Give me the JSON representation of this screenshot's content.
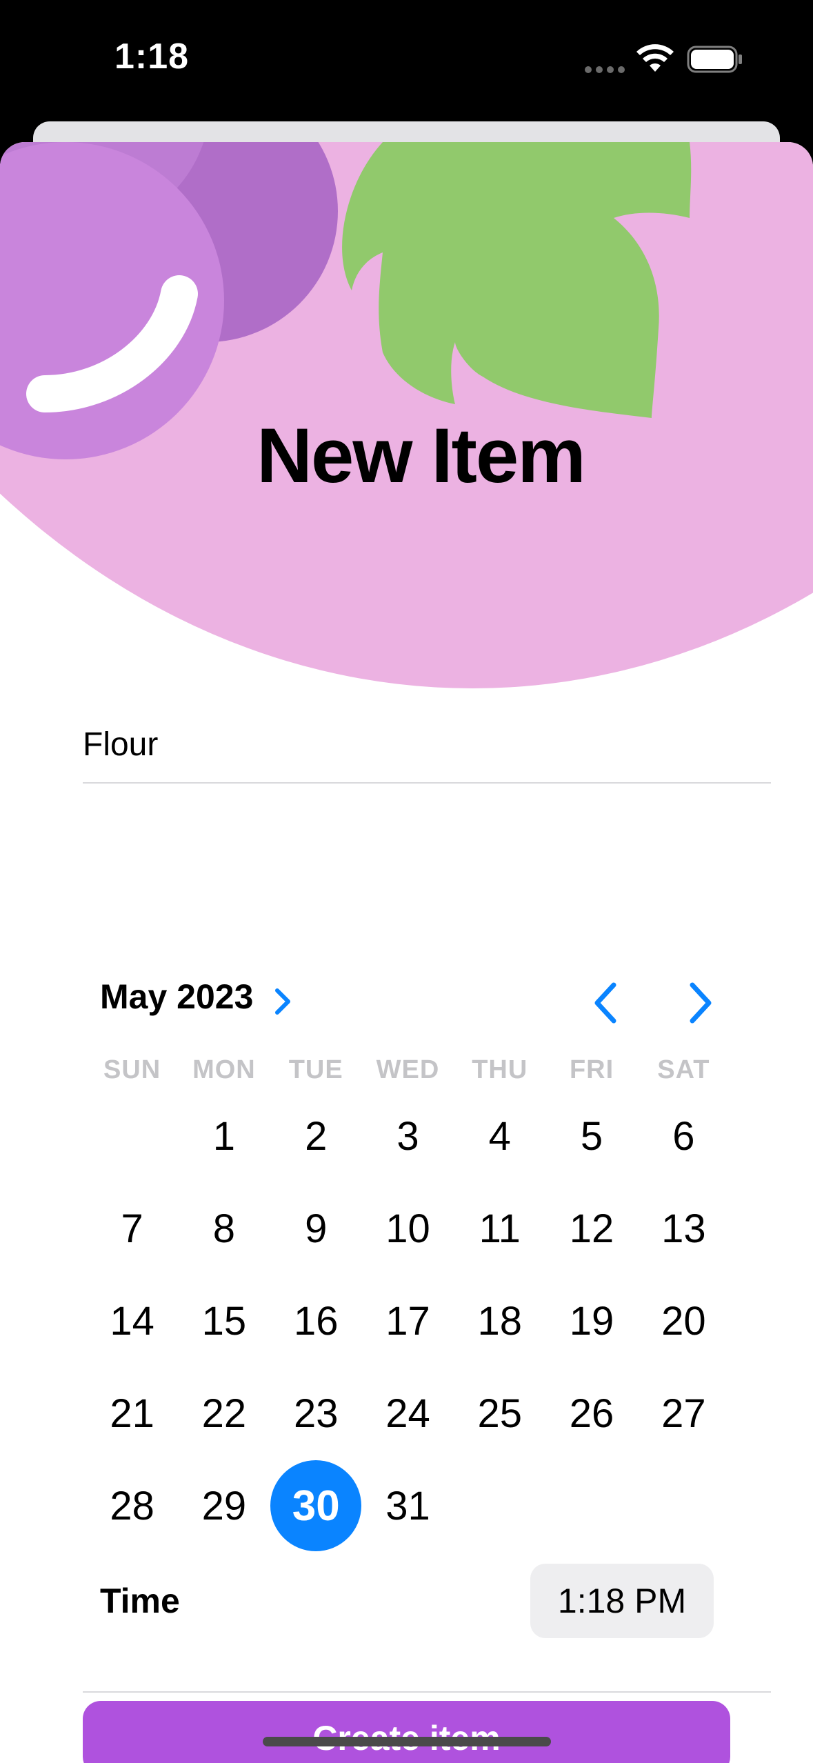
{
  "status_bar": {
    "time": "1:18",
    "icons": [
      "signal-dots-icon",
      "wifi-icon",
      "battery-icon"
    ]
  },
  "header": {
    "title": "New Item",
    "art": "grapes-illustration",
    "background_color": "#ecb2e2"
  },
  "form": {
    "name_value": "Flour",
    "calendar": {
      "month_label": "May 2023",
      "weekdays": [
        "SUN",
        "MON",
        "TUE",
        "WED",
        "THU",
        "FRI",
        "SAT"
      ],
      "leading_blanks": 1,
      "days": [
        "1",
        "2",
        "3",
        "4",
        "5",
        "6",
        "7",
        "8",
        "9",
        "10",
        "11",
        "12",
        "13",
        "14",
        "15",
        "16",
        "17",
        "18",
        "19",
        "20",
        "21",
        "22",
        "23",
        "24",
        "25",
        "26",
        "27",
        "28",
        "29",
        "30",
        "31"
      ],
      "selected_day": "30",
      "icons": [
        "chevron-right-icon",
        "chevron-left-icon"
      ]
    },
    "time_label": "Time",
    "time_value": "1:18 PM",
    "create_label": "Create item"
  },
  "colors": {
    "accent_blue": "#0a84ff",
    "button_purple": "#af52de",
    "grape_light": "#c985dc",
    "grape_dark": "#b06ec8",
    "leaf_green": "#91c96c"
  }
}
